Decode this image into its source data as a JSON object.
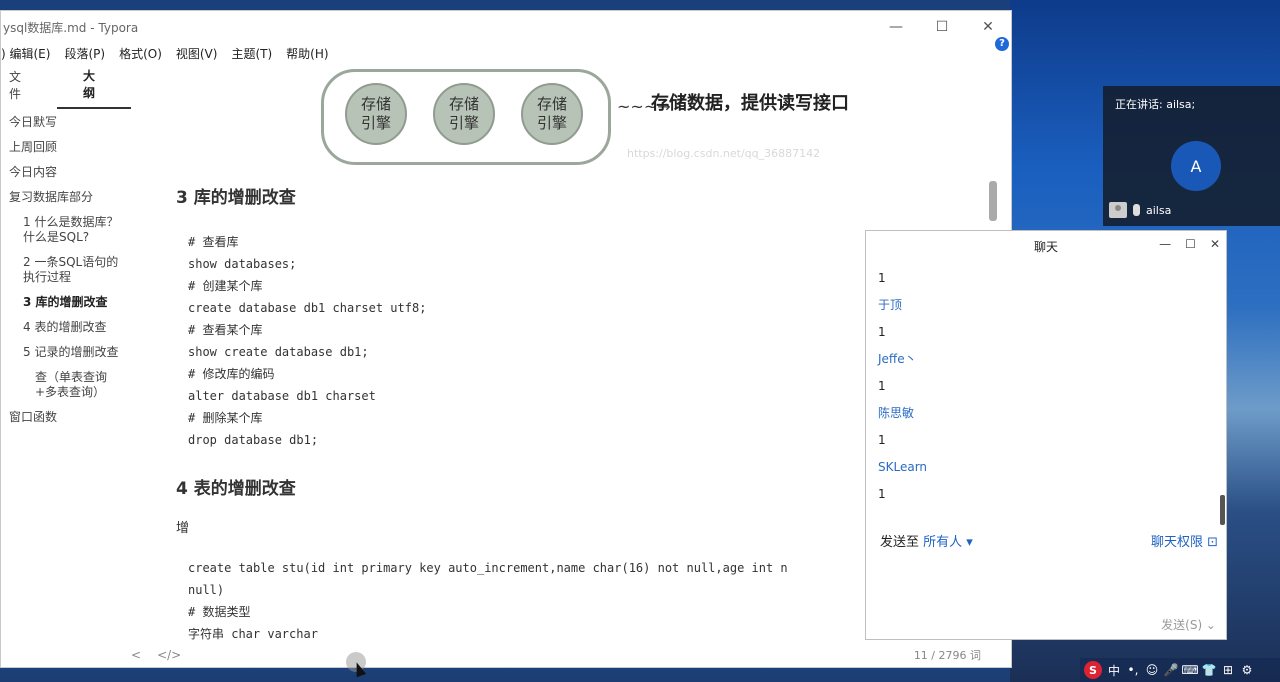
{
  "typora": {
    "title": "ysql数据库.md - Typora",
    "menu": [
      ") 编辑(E)",
      "段落(P)",
      "格式(O)",
      "视图(V)",
      "主题(T)",
      "帮助(H)"
    ],
    "win_min": "—",
    "win_max": "☐",
    "win_close": "✕",
    "help_icon": "?",
    "sidebar_tabs": [
      "文件",
      "大纲"
    ],
    "outline": [
      {
        "text": "今日默写",
        "level": 1
      },
      {
        "text": "上周回顾",
        "level": 1
      },
      {
        "text": "今日内容",
        "level": 1
      },
      {
        "text": "复习数据库部分",
        "level": 1
      },
      {
        "text": "1 什么是数据库？什么是SQL?",
        "level": 2
      },
      {
        "text": "2 一条SQL语句的执行过程",
        "level": 2
      },
      {
        "text": "3 库的增删改查",
        "level": 2,
        "current": true
      },
      {
        "text": "4 表的增删改查",
        "level": 2
      },
      {
        "text": "5 记录的增删改查",
        "level": 2
      },
      {
        "text": "查（单表查询+多表查询）",
        "level": 3
      },
      {
        "text": "窗口函数",
        "level": 1
      }
    ],
    "sketch": {
      "engine_top": "存储",
      "engine_bottom": "引擎",
      "arrow": "~~~→",
      "note": "存储数据，提供读写接口"
    },
    "watermark": "https://blog.csdn.net/qq_36887142",
    "h3_db": "3 库的增删改查",
    "code_db": [
      "# 查看库",
      "show databases;",
      "# 创建某个库",
      "create database db1 charset utf8;",
      "# 查看某个库",
      "show create database db1;",
      "# 修改库的编码",
      "alter database db1 charset",
      "# 删除某个库",
      "drop database db1;"
    ],
    "h3_table": "4 表的增删改查",
    "para_add": "增",
    "code_table": [
      "create table stu(id int primary key auto_increment,name char(16) not null,age int n",
      "null)",
      "# 数据类型",
      "字符串 char varchar"
    ],
    "status_left_icon": "<",
    "status_code_icon": "</>",
    "word_count": "11 / 2796 词"
  },
  "speaker": {
    "speaking": "正在讲话: ailsa;",
    "avatar_letter": "A",
    "name": "ailsa"
  },
  "chat": {
    "title": "聊天",
    "messages": [
      {
        "name": "",
        "text": "1"
      },
      {
        "name": "于顶",
        "text": "1"
      },
      {
        "name": "Jeffe丶",
        "text": "1"
      },
      {
        "name": "陈思敏",
        "text": "1"
      },
      {
        "name": "SKLearn",
        "text": " 1"
      }
    ],
    "send_to_label": "发送至",
    "send_to_target": "所有人 ▾",
    "permission": "聊天权限 ⊡",
    "send_button": "发送(S)  ⌄"
  },
  "tray": {
    "ime": "中",
    "items": [
      "•,",
      "☺",
      "🎤",
      "⌨",
      "👕",
      "⊞",
      "⚙"
    ]
  }
}
